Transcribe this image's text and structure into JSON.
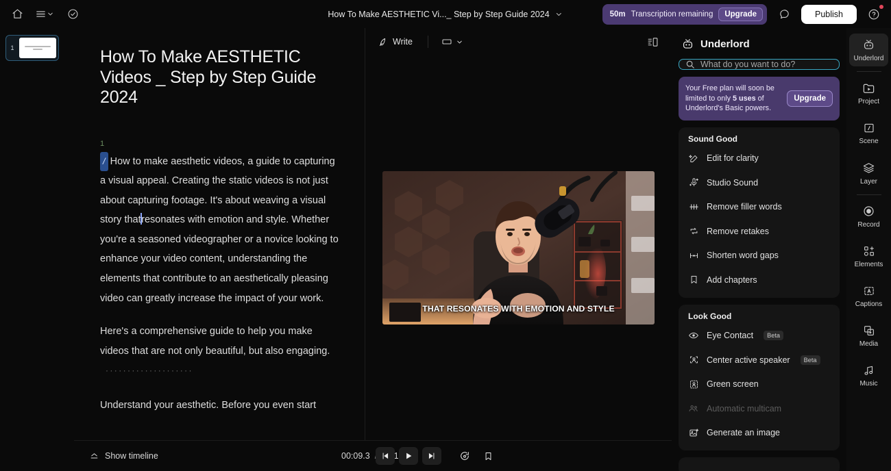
{
  "topbar": {
    "home_icon": "home-icon",
    "menu_icon": "hamburger-menu-icon",
    "tasks_icon": "check-circle-icon",
    "project_title": "How To Make AESTHETIC Vi..._ Step by Step Guide 2024",
    "transcription_amount": "50m",
    "transcription_label": "Transcription remaining",
    "upgrade_label": "Upgrade",
    "comment_icon": "comment-icon",
    "publish_label": "Publish",
    "help_icon": "help-circle-icon"
  },
  "scenes": {
    "items": [
      {
        "number": "1"
      }
    ]
  },
  "preview_toolbar": {
    "write_label": "Write",
    "write_icon": "pen-icon",
    "ratio_icon": "aspect-ratio-icon",
    "ratio_chevron": "chevron-down-icon",
    "layout_icon": "panel-layout-icon"
  },
  "video": {
    "caption": "THAT RESONATES WITH EMOTION AND STYLE"
  },
  "transcript": {
    "title": "How To Make AESTHETIC Videos _ Step by Step Guide 2024",
    "speaker_number": "1",
    "slash_marker": "/",
    "paragraph1_a": "How to make aesthetic videos, a guide to capturing a visual appeal. Creating the static videos is not just about capturing footage. It's about weaving a visual story that",
    "paragraph1_b": "resonates with emotion and style. Whether you're a seasoned videographer or a novice looking to enhance your video content, understanding the elements that contribute to an aesthetically pleasing video can greatly increase the impact of your work.",
    "paragraph2": "Here's a comprehensive guide to help you make videos that are not only beautiful, but also engaging.",
    "gap_dots": "····················",
    "paragraph3": "Understand your aesthetic. Before you even start"
  },
  "transport": {
    "show_timeline_label": "Show timeline",
    "show_timeline_icon": "timeline-expand-icon",
    "current_time": "00:09.3",
    "time_separator": "/",
    "total_time": "03:19.5",
    "prev_icon": "skip-previous-icon",
    "play_icon": "play-icon",
    "next_icon": "skip-next-icon",
    "loop_icon": "loop-icon",
    "bookmark_icon": "bookmark-icon"
  },
  "ai_panel": {
    "title": "Underlord",
    "robot_icon": "robot-icon",
    "search_icon": "search-icon",
    "search_placeholder": "What do you want to do?",
    "search_value": "",
    "upsell_text_1": "Your Free plan will soon be limited to only ",
    "upsell_bold": "5 uses",
    "upsell_text_2": " of Underlord's Basic powers.",
    "upsell_button": "Upgrade",
    "sections": [
      {
        "title": "Sound Good",
        "items": [
          {
            "label": "Edit for clarity",
            "icon": "magic-wand-icon",
            "badge": "",
            "disabled": false
          },
          {
            "label": "Studio Sound",
            "icon": "microphone-sparkle-icon",
            "badge": "",
            "disabled": false
          },
          {
            "label": "Remove filler words",
            "icon": "strikethrough-icon",
            "badge": "",
            "disabled": false
          },
          {
            "label": "Remove retakes",
            "icon": "repeat-icon",
            "badge": "",
            "disabled": false
          },
          {
            "label": "Shorten word gaps",
            "icon": "word-gap-icon",
            "badge": "",
            "disabled": false
          },
          {
            "label": "Add chapters",
            "icon": "bookmark-icon",
            "badge": "",
            "disabled": false
          }
        ]
      },
      {
        "title": "Look Good",
        "items": [
          {
            "label": "Eye Contact",
            "icon": "eye-icon",
            "badge": "Beta",
            "disabled": false
          },
          {
            "label": "Center active speaker",
            "icon": "person-frame-icon",
            "badge": "Beta",
            "disabled": false
          },
          {
            "label": "Green screen",
            "icon": "person-cutout-icon",
            "badge": "",
            "disabled": false
          },
          {
            "label": "Automatic multicam",
            "icon": "multicam-people-icon",
            "badge": "",
            "disabled": true
          },
          {
            "label": "Generate an image",
            "icon": "image-sparkle-icon",
            "badge": "",
            "disabled": false
          }
        ]
      }
    ]
  },
  "rail": {
    "items": [
      {
        "label": "Underlord",
        "icon": "robot-icon",
        "active": true,
        "sep_after": true
      },
      {
        "label": "Project",
        "icon": "project-icon",
        "active": false,
        "sep_after": false
      },
      {
        "label": "Scene",
        "icon": "scene-icon",
        "active": false,
        "sep_after": false
      },
      {
        "label": "Layer",
        "icon": "layers-icon",
        "active": false,
        "sep_after": true
      },
      {
        "label": "Record",
        "icon": "record-icon",
        "active": false,
        "sep_after": false
      },
      {
        "label": "Elements",
        "icon": "elements-icon",
        "active": false,
        "sep_after": false
      },
      {
        "label": "Captions",
        "icon": "captions-icon",
        "active": false,
        "sep_after": false
      },
      {
        "label": "Media",
        "icon": "media-icon",
        "active": false,
        "sep_after": false
      },
      {
        "label": "Music",
        "icon": "music-icon",
        "active": false,
        "sep_after": false
      }
    ]
  },
  "colors": {
    "background": "#0a0a0a",
    "panel": "#151515",
    "accent_purple": "#493a6c",
    "accent_cyan": "#3aa8c4",
    "publish_bg": "#ffffff",
    "marker_blue": "#2a4f8f",
    "speaker_green": "#6d8f62"
  }
}
